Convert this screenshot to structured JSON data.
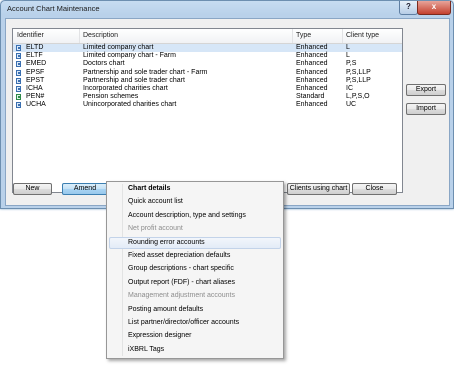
{
  "window": {
    "title": "Account Chart Maintenance",
    "help_label": "?",
    "close_label": "x"
  },
  "table": {
    "headers": [
      "Identifier",
      "Description",
      "Type",
      "Client type"
    ],
    "rows": [
      {
        "id": "ELTD",
        "desc": "Limited company chart",
        "type": "Enhanced",
        "client": "L",
        "icon": "chart-icon"
      },
      {
        "id": "ELTF",
        "desc": "Limited company chart - Farm",
        "type": "Enhanced",
        "client": "L",
        "icon": "chart-icon"
      },
      {
        "id": "EMED",
        "desc": "Doctors chart",
        "type": "Enhanced",
        "client": "P,S",
        "icon": "chart-icon"
      },
      {
        "id": "EPSF",
        "desc": "Partnership and sole trader chart - Farm",
        "type": "Enhanced",
        "client": "P,S,LLP",
        "icon": "chart-icon"
      },
      {
        "id": "EPST",
        "desc": "Partnership and sole trader chart",
        "type": "Enhanced",
        "client": "P,S,LLP",
        "icon": "chart-icon"
      },
      {
        "id": "ICHA",
        "desc": "Incorporated charities chart",
        "type": "Enhanced",
        "client": "IC",
        "icon": "chart-icon"
      },
      {
        "id": "PEN#",
        "desc": "Pension schemes",
        "type": "Standard",
        "client": "L,P,S,O",
        "icon": "standard-chart-icon"
      },
      {
        "id": "UCHA",
        "desc": "Unincorporated charities chart",
        "type": "Enhanced",
        "client": "UC",
        "icon": "chart-icon"
      }
    ]
  },
  "side_buttons": {
    "export": "Export",
    "import": "Import"
  },
  "bottom_buttons": {
    "new": "New",
    "amend": "Amend",
    "clients": "Clients using chart",
    "close": "Close"
  },
  "menu": {
    "items": [
      {
        "label": "Chart details",
        "state": "header"
      },
      {
        "label": "Quick account list",
        "state": "enabled"
      },
      {
        "label": "Account description, type and settings",
        "state": "enabled"
      },
      {
        "label": "Net profit account",
        "state": "disabled"
      },
      {
        "label": "Rounding error accounts",
        "state": "hover"
      },
      {
        "label": "Fixed asset depreciation defaults",
        "state": "enabled"
      },
      {
        "label": "Group descriptions - chart specific",
        "state": "enabled"
      },
      {
        "label": "Output report (FDF) - chart aliases",
        "state": "enabled"
      },
      {
        "label": "Management adjustment accounts",
        "state": "disabled"
      },
      {
        "label": "Posting amount defaults",
        "state": "enabled"
      },
      {
        "label": "List partner/director/officer accounts",
        "state": "enabled"
      },
      {
        "label": "Expression designer",
        "state": "enabled"
      },
      {
        "label": "iXBRL Tags",
        "state": "enabled"
      }
    ]
  }
}
